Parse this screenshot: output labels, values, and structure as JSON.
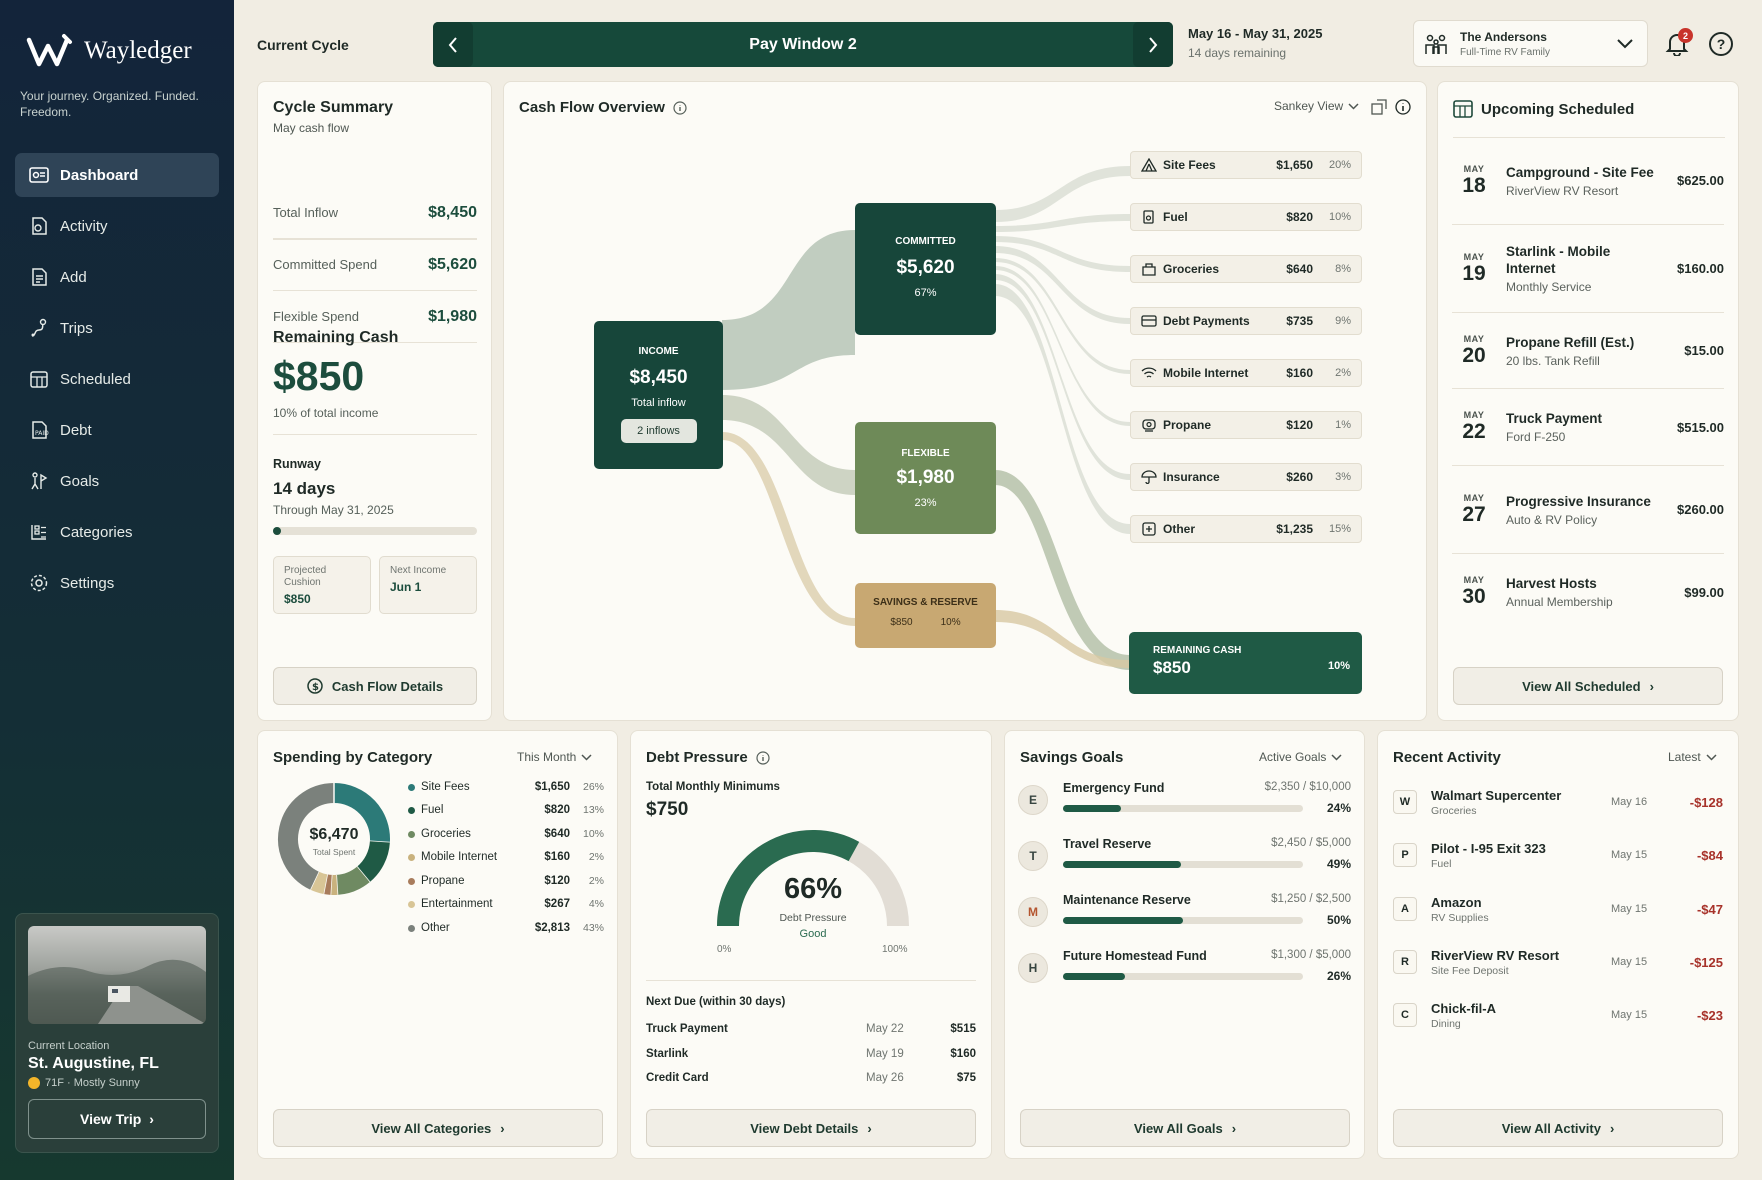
{
  "app": {
    "name": "Wayledger",
    "tagline": "Your journey. Organized. Funded. Freedom."
  },
  "nav": [
    {
      "label": "Dashboard",
      "icon": "dashboard-icon",
      "active": true
    },
    {
      "label": "Activity",
      "icon": "activity-icon"
    },
    {
      "label": "Add",
      "icon": "add-icon"
    },
    {
      "label": "Trips",
      "icon": "trips-icon"
    },
    {
      "label": "Scheduled",
      "icon": "calendar-icon"
    },
    {
      "label": "Debt",
      "icon": "debt-icon"
    },
    {
      "label": "Goals",
      "icon": "goals-icon"
    },
    {
      "label": "Categories",
      "icon": "categories-icon"
    },
    {
      "label": "Settings",
      "icon": "gear-icon"
    }
  ],
  "location": {
    "label": "Current Location",
    "city": "St. Augustine, FL",
    "weather": "71F · Mostly Sunny",
    "button": "View Trip"
  },
  "header": {
    "cycle_label": "Current Cycle",
    "cycle_title": "Pay Window 2",
    "dates": "May 16 - May 31, 2025",
    "remaining": "14 days remaining",
    "account_name": "The Andersons",
    "account_sub": "Full-Time RV Family",
    "notifications": "2"
  },
  "summary": {
    "title": "Cycle Summary",
    "subtitle": "May cash flow",
    "rows": [
      {
        "label": "Total Inflow",
        "value": "$8,450"
      },
      {
        "label": "Committed Spend",
        "value": "$5,620"
      },
      {
        "label": "Flexible Spend",
        "value": "$1,980"
      }
    ],
    "remaining_label": "Remaining Cash",
    "remaining_value": "$850",
    "remaining_note": "10% of total income",
    "runway_label": "Runway",
    "runway_value": "14 days",
    "runway_through": "Through May 31, 2025",
    "runway_progress": 0.04,
    "cushion_label": "Projected Cushion",
    "cushion_value": "$850",
    "next_income_label": "Next Income",
    "next_income_value": "Jun 1",
    "button": "Cash Flow Details"
  },
  "cashflow": {
    "title": "Cash Flow Overview",
    "view": "Sankey View",
    "income": {
      "label": "INCOME",
      "value": "$8,450",
      "sub": "Total inflow",
      "pill": "2 inflows"
    },
    "committed": {
      "label": "COMMITTED",
      "value": "$5,620",
      "pct": "67%"
    },
    "flexible": {
      "label": "FLEXIBLE",
      "value": "$1,980",
      "pct": "23%"
    },
    "savings": {
      "label": "SAVINGS & RESERVE",
      "value": "$850",
      "pct": "10%"
    },
    "remaining": {
      "label": "REMAINING CASH",
      "value": "$850",
      "pct": "10%"
    },
    "categories": [
      {
        "name": "Site Fees",
        "amount": "$1,650",
        "pct": "20%",
        "icon": "tent-icon"
      },
      {
        "name": "Fuel",
        "amount": "$820",
        "pct": "10%",
        "icon": "fuel-icon"
      },
      {
        "name": "Groceries",
        "amount": "$640",
        "pct": "8%",
        "icon": "basket-icon"
      },
      {
        "name": "Debt Payments",
        "amount": "$735",
        "pct": "9%",
        "icon": "card-icon"
      },
      {
        "name": "Mobile Internet",
        "amount": "$160",
        "pct": "2%",
        "icon": "wifi-icon"
      },
      {
        "name": "Propane",
        "amount": "$120",
        "pct": "1%",
        "icon": "propane-icon"
      },
      {
        "name": "Insurance",
        "amount": "$260",
        "pct": "3%",
        "icon": "umbrella-icon"
      },
      {
        "name": "Other",
        "amount": "$1,235",
        "pct": "15%",
        "icon": "plus-box-icon"
      }
    ]
  },
  "upcoming": {
    "title": "Upcoming Scheduled",
    "items": [
      {
        "month": "MAY",
        "day": "18",
        "title": "Campground - Site Fee",
        "sub": "RiverView RV Resort",
        "amount": "$625.00"
      },
      {
        "month": "MAY",
        "day": "19",
        "title": "Starlink - Mobile Internet",
        "sub": "Monthly Service",
        "amount": "$160.00"
      },
      {
        "month": "MAY",
        "day": "20",
        "title": "Propane Refill (Est.)",
        "sub": "20 lbs. Tank Refill",
        "amount": "$15.00"
      },
      {
        "month": "MAY",
        "day": "22",
        "title": "Truck Payment",
        "sub": "Ford F-250",
        "amount": "$515.00"
      },
      {
        "month": "MAY",
        "day": "27",
        "title": "Progressive Insurance",
        "sub": "Auto & RV Policy",
        "amount": "$260.00"
      },
      {
        "month": "MAY",
        "day": "30",
        "title": "Harvest Hosts",
        "sub": "Annual Membership",
        "amount": "$99.00"
      }
    ],
    "button": "View All Scheduled"
  },
  "spending": {
    "title": "Spending by Category",
    "filter": "This Month",
    "total": "$6,470",
    "total_label": "Total Spent",
    "items": [
      {
        "name": "Site Fees",
        "amount": "$1,650",
        "pct": "26%",
        "color": "#2c7a78",
        "frac": 0.26
      },
      {
        "name": "Fuel",
        "amount": "$820",
        "pct": "13%",
        "color": "#1f5a45",
        "frac": 0.13
      },
      {
        "name": "Groceries",
        "amount": "$640",
        "pct": "10%",
        "color": "#6f8a62",
        "frac": 0.1
      },
      {
        "name": "Mobile Internet",
        "amount": "$160",
        "pct": "2%",
        "color": "#c9b27e",
        "frac": 0.02
      },
      {
        "name": "Propane",
        "amount": "$120",
        "pct": "2%",
        "color": "#a87c5c",
        "frac": 0.02
      },
      {
        "name": "Entertainment",
        "amount": "$267",
        "pct": "4%",
        "color": "#d8c596",
        "frac": 0.04
      },
      {
        "name": "Other",
        "amount": "$2,813",
        "pct": "43%",
        "color": "#7b817c",
        "frac": 0.43
      }
    ],
    "button": "View All Categories"
  },
  "debt": {
    "title": "Debt Pressure",
    "min_label": "Total Monthly Minimums",
    "min_value": "$750",
    "gauge_pct": "66%",
    "gauge_frac": 0.66,
    "gauge_label": "Debt Pressure",
    "gauge_status": "Good",
    "gauge_min": "0%",
    "gauge_max": "100%",
    "next_label": "Next Due (within 30 days)",
    "due": [
      {
        "name": "Truck Payment",
        "date": "May 22",
        "amount": "$515"
      },
      {
        "name": "Starlink",
        "date": "May 19",
        "amount": "$160"
      },
      {
        "name": "Credit Card",
        "date": "May 26",
        "amount": "$75"
      }
    ],
    "button": "View Debt Details"
  },
  "goals": {
    "title": "Savings Goals",
    "filter": "Active Goals",
    "items": [
      {
        "letter": "E",
        "name": "Emergency Fund",
        "amount": "$2,350 / $10,000",
        "pct": "24%",
        "frac": 0.24,
        "color": "#374540"
      },
      {
        "letter": "T",
        "name": "Travel Reserve",
        "amount": "$2,450 / $5,000",
        "pct": "49%",
        "frac": 0.49,
        "color": "#374540"
      },
      {
        "letter": "M",
        "name": "Maintenance Reserve",
        "amount": "$1,250 / $2,500",
        "pct": "50%",
        "frac": 0.5,
        "color": "#b4552f"
      },
      {
        "letter": "H",
        "name": "Future Homestead Fund",
        "amount": "$1,300 / $5,000",
        "pct": "26%",
        "frac": 0.26,
        "color": "#374540"
      }
    ],
    "button": "View All Goals"
  },
  "activity": {
    "title": "Recent Activity",
    "filter": "Latest",
    "items": [
      {
        "letter": "W",
        "name": "Walmart Supercenter",
        "cat": "Groceries",
        "date": "May 16",
        "amount": "-$128"
      },
      {
        "letter": "P",
        "name": "Pilot - I-95 Exit 323",
        "cat": "Fuel",
        "date": "May 15",
        "amount": "-$84"
      },
      {
        "letter": "A",
        "name": "Amazon",
        "cat": "RV Supplies",
        "date": "May 15",
        "amount": "-$47"
      },
      {
        "letter": "R",
        "name": "RiverView RV Resort",
        "cat": "Site Fee Deposit",
        "date": "May 15",
        "amount": "-$125"
      },
      {
        "letter": "C",
        "name": "Chick-fil-A",
        "cat": "Dining",
        "date": "May 15",
        "amount": "-$23"
      }
    ],
    "button": "View All Activity"
  }
}
